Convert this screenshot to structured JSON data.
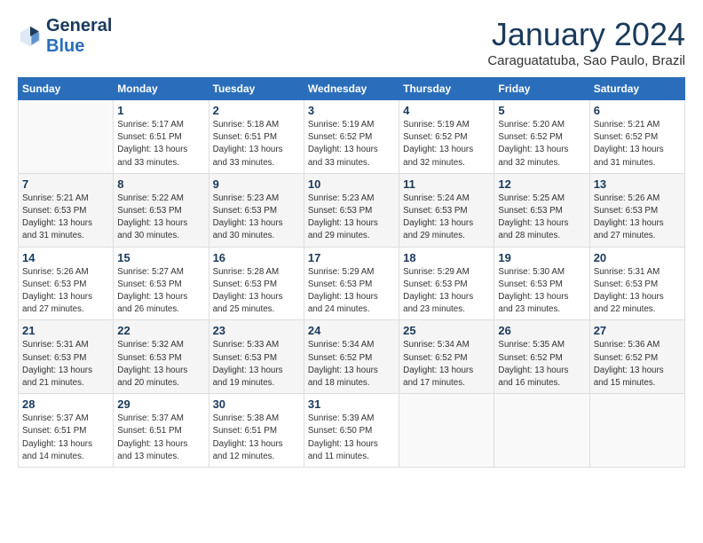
{
  "logo": {
    "text1": "General",
    "text2": "Blue"
  },
  "title": "January 2024",
  "subtitle": "Caraguatatuba, Sao Paulo, Brazil",
  "days_of_week": [
    "Sunday",
    "Monday",
    "Tuesday",
    "Wednesday",
    "Thursday",
    "Friday",
    "Saturday"
  ],
  "weeks": [
    [
      {
        "day": "",
        "info": ""
      },
      {
        "day": "1",
        "info": "Sunrise: 5:17 AM\nSunset: 6:51 PM\nDaylight: 13 hours\nand 33 minutes."
      },
      {
        "day": "2",
        "info": "Sunrise: 5:18 AM\nSunset: 6:51 PM\nDaylight: 13 hours\nand 33 minutes."
      },
      {
        "day": "3",
        "info": "Sunrise: 5:19 AM\nSunset: 6:52 PM\nDaylight: 13 hours\nand 33 minutes."
      },
      {
        "day": "4",
        "info": "Sunrise: 5:19 AM\nSunset: 6:52 PM\nDaylight: 13 hours\nand 32 minutes."
      },
      {
        "day": "5",
        "info": "Sunrise: 5:20 AM\nSunset: 6:52 PM\nDaylight: 13 hours\nand 32 minutes."
      },
      {
        "day": "6",
        "info": "Sunrise: 5:21 AM\nSunset: 6:52 PM\nDaylight: 13 hours\nand 31 minutes."
      }
    ],
    [
      {
        "day": "7",
        "info": "Sunrise: 5:21 AM\nSunset: 6:53 PM\nDaylight: 13 hours\nand 31 minutes."
      },
      {
        "day": "8",
        "info": "Sunrise: 5:22 AM\nSunset: 6:53 PM\nDaylight: 13 hours\nand 30 minutes."
      },
      {
        "day": "9",
        "info": "Sunrise: 5:23 AM\nSunset: 6:53 PM\nDaylight: 13 hours\nand 30 minutes."
      },
      {
        "day": "10",
        "info": "Sunrise: 5:23 AM\nSunset: 6:53 PM\nDaylight: 13 hours\nand 29 minutes."
      },
      {
        "day": "11",
        "info": "Sunrise: 5:24 AM\nSunset: 6:53 PM\nDaylight: 13 hours\nand 29 minutes."
      },
      {
        "day": "12",
        "info": "Sunrise: 5:25 AM\nSunset: 6:53 PM\nDaylight: 13 hours\nand 28 minutes."
      },
      {
        "day": "13",
        "info": "Sunrise: 5:26 AM\nSunset: 6:53 PM\nDaylight: 13 hours\nand 27 minutes."
      }
    ],
    [
      {
        "day": "14",
        "info": "Sunrise: 5:26 AM\nSunset: 6:53 PM\nDaylight: 13 hours\nand 27 minutes."
      },
      {
        "day": "15",
        "info": "Sunrise: 5:27 AM\nSunset: 6:53 PM\nDaylight: 13 hours\nand 26 minutes."
      },
      {
        "day": "16",
        "info": "Sunrise: 5:28 AM\nSunset: 6:53 PM\nDaylight: 13 hours\nand 25 minutes."
      },
      {
        "day": "17",
        "info": "Sunrise: 5:29 AM\nSunset: 6:53 PM\nDaylight: 13 hours\nand 24 minutes."
      },
      {
        "day": "18",
        "info": "Sunrise: 5:29 AM\nSunset: 6:53 PM\nDaylight: 13 hours\nand 23 minutes."
      },
      {
        "day": "19",
        "info": "Sunrise: 5:30 AM\nSunset: 6:53 PM\nDaylight: 13 hours\nand 23 minutes."
      },
      {
        "day": "20",
        "info": "Sunrise: 5:31 AM\nSunset: 6:53 PM\nDaylight: 13 hours\nand 22 minutes."
      }
    ],
    [
      {
        "day": "21",
        "info": "Sunrise: 5:31 AM\nSunset: 6:53 PM\nDaylight: 13 hours\nand 21 minutes."
      },
      {
        "day": "22",
        "info": "Sunrise: 5:32 AM\nSunset: 6:53 PM\nDaylight: 13 hours\nand 20 minutes."
      },
      {
        "day": "23",
        "info": "Sunrise: 5:33 AM\nSunset: 6:53 PM\nDaylight: 13 hours\nand 19 minutes."
      },
      {
        "day": "24",
        "info": "Sunrise: 5:34 AM\nSunset: 6:52 PM\nDaylight: 13 hours\nand 18 minutes."
      },
      {
        "day": "25",
        "info": "Sunrise: 5:34 AM\nSunset: 6:52 PM\nDaylight: 13 hours\nand 17 minutes."
      },
      {
        "day": "26",
        "info": "Sunrise: 5:35 AM\nSunset: 6:52 PM\nDaylight: 13 hours\nand 16 minutes."
      },
      {
        "day": "27",
        "info": "Sunrise: 5:36 AM\nSunset: 6:52 PM\nDaylight: 13 hours\nand 15 minutes."
      }
    ],
    [
      {
        "day": "28",
        "info": "Sunrise: 5:37 AM\nSunset: 6:51 PM\nDaylight: 13 hours\nand 14 minutes."
      },
      {
        "day": "29",
        "info": "Sunrise: 5:37 AM\nSunset: 6:51 PM\nDaylight: 13 hours\nand 13 minutes."
      },
      {
        "day": "30",
        "info": "Sunrise: 5:38 AM\nSunset: 6:51 PM\nDaylight: 13 hours\nand 12 minutes."
      },
      {
        "day": "31",
        "info": "Sunrise: 5:39 AM\nSunset: 6:50 PM\nDaylight: 13 hours\nand 11 minutes."
      },
      {
        "day": "",
        "info": ""
      },
      {
        "day": "",
        "info": ""
      },
      {
        "day": "",
        "info": ""
      }
    ]
  ]
}
